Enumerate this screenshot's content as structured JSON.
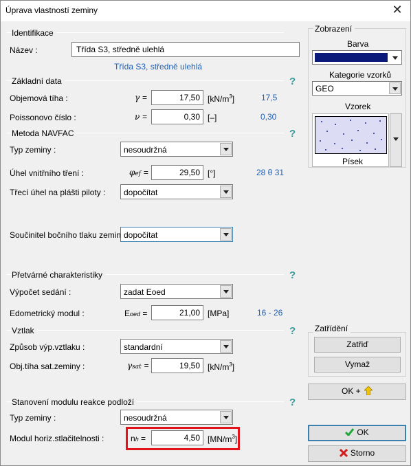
{
  "window": {
    "title": "Úprava vlastností zeminy",
    "close_glyph": "✕"
  },
  "identification": {
    "section_title": "Identifikace",
    "name_label": "Název :",
    "name_value": "Třída S3, středně ulehlá",
    "name_hint": "Třída S3, středně ulehlá"
  },
  "basic": {
    "section_title": "Základní data",
    "help": "?",
    "unit_weight": {
      "label": "Objemová tíha :",
      "symbol": "γ",
      "eq": "=",
      "value": "17,50",
      "unit": "[kN/m",
      "unit_sup": "3",
      "unit_end": "]",
      "hint": "17,5"
    },
    "poisson": {
      "label": "Poissonovo číslo :",
      "symbol": "ν",
      "eq": "=",
      "value": "0,30",
      "unit": "[–]",
      "hint": "0,30"
    }
  },
  "navfac": {
    "section_title": "Metoda NAVFAC",
    "help": "?",
    "soil_type": {
      "label": "Typ zeminy :",
      "value": "nesoudržná"
    },
    "friction_angle": {
      "label": "Úhel vnitřního tření :",
      "symbol": "φ",
      "sub": "ef",
      "eq": "=",
      "value": "29,50",
      "unit": "[°]",
      "hint": "28 θ 31"
    },
    "pile_friction": {
      "label": "Třecí úhel na plášti piloty :",
      "value": "dopočítat"
    },
    "lateral_pressure": {
      "label": "Součinitel bočního tlaku zeminy :",
      "value": "dopočítat"
    }
  },
  "deformation": {
    "section_title": "Přetvárné charakteristiky",
    "help": "?",
    "settlement": {
      "label": "Výpočet sedání :",
      "value": "zadat Eoed"
    },
    "oedometric": {
      "label": "Edometrický modul :",
      "symbol": "E",
      "sub": "oed",
      "eq": "=",
      "value": "21,00",
      "unit": "[MPa]",
      "hint": "16 - 26"
    }
  },
  "uplift": {
    "section_title": "Vztlak",
    "help": "?",
    "mode": {
      "label": "Způsob výp.vztlaku :",
      "value": "standardní"
    },
    "sat_weight": {
      "label": "Obj.tíha sat.zeminy :",
      "symbol": "γ",
      "sub": "sat",
      "eq": "=",
      "value": "19,50",
      "unit": "[kN/m",
      "unit_sup": "3",
      "unit_end": "]"
    }
  },
  "subgrade": {
    "section_title": "Stanovení modulu reakce podloží",
    "help": "?",
    "soil_type": {
      "label": "Typ zeminy :",
      "value": "nesoudržná"
    },
    "modulus": {
      "label": "Modul horiz.stlačitelnosti :",
      "symbol": "n",
      "sub": "h",
      "eq": "=",
      "value": "4,50",
      "unit": "[MN/m",
      "unit_sup": "3",
      "unit_end": "]"
    }
  },
  "display": {
    "group_title": "Zobrazení",
    "color_label": "Barva",
    "color_value": "#0a1a7a",
    "category_label": "Kategorie vzorků",
    "category_value": "GEO",
    "pattern_label": "Vzorek",
    "pattern_name": "Písek"
  },
  "classification": {
    "group_title": "Zatřídění",
    "classify_button": "Zatřiď",
    "clear_button": "Vymaž"
  },
  "buttons": {
    "ok_plus": "OK +",
    "ok": "OK",
    "cancel": "Storno"
  },
  "colors": {
    "hint_blue": "#1f5fb5",
    "help_teal": "#3a9a9a",
    "highlight_red": "#e1131b",
    "ok_green": "#1fa83a",
    "cancel_red": "#d41c1c",
    "arrow_yellow": "#f0c400"
  }
}
